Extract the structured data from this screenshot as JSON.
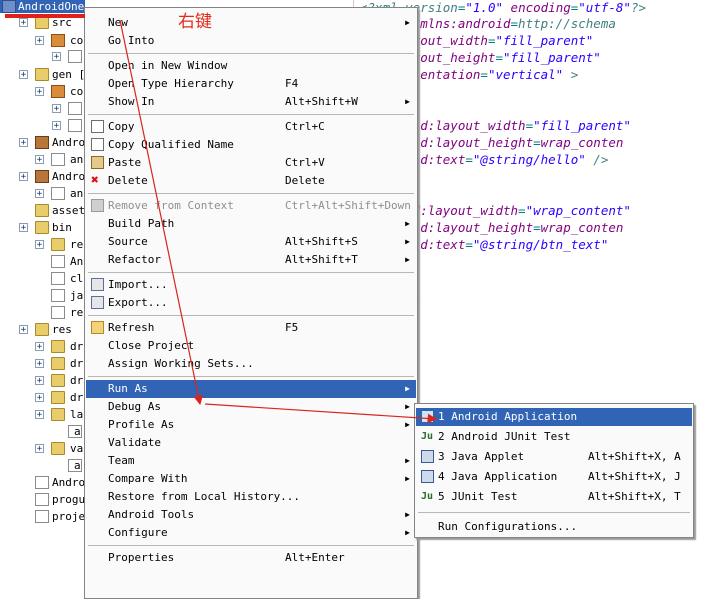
{
  "tree": {
    "project_name": "AndroidOne",
    "rows": [
      {
        "label": "src"
      },
      {
        "label": "co"
      },
      {
        "label": "J"
      },
      {
        "label": "gen ["
      },
      {
        "label": "co"
      },
      {
        "label": "J"
      },
      {
        "label": "J"
      },
      {
        "label": "Andro"
      },
      {
        "label": "and"
      },
      {
        "label": "Andro"
      },
      {
        "label": "and"
      },
      {
        "label": "asset"
      },
      {
        "label": "bin"
      },
      {
        "label": "re"
      },
      {
        "label": "An"
      },
      {
        "label": "cl"
      },
      {
        "label": "ja"
      },
      {
        "label": "re"
      },
      {
        "label": "res"
      },
      {
        "label": "dr"
      },
      {
        "label": "dr"
      },
      {
        "label": "dr"
      },
      {
        "label": "dr"
      },
      {
        "label": "la"
      },
      {
        "label": "a"
      },
      {
        "label": "va"
      },
      {
        "label": "a"
      },
      {
        "label": "Andro"
      },
      {
        "label": "progu"
      },
      {
        "label": "proje"
      }
    ]
  },
  "annotation": {
    "text": "右键"
  },
  "editor": {
    "lines": [
      "<?xml version=\"1.0\" encoding=\"utf-8\"?>",
      "Layout xmlns:android=\"http://schema",
      "roid:layout_width=\"fill_parent\"",
      "roid:layout_height=\"fill_parent\"",
      "roid:orientation=\"vertical\" >",
      "",
      "xtView",
      "  android:layout_width=\"fill_parent\"",
      "  android:layout_height=\"wrap_conten",
      "  android:text=\"@string/hello\" />",
      "",
      "tton",
      " android:layout_width=\"wrap_content\"",
      "  android:layout_height=\"wrap_conten",
      "  android:text=\"@string/btn_text\"",
      "  />",
      "",
      "rLayout>"
    ]
  },
  "context_menu": {
    "items": [
      {
        "label": "New",
        "accel": "",
        "arrow": true
      },
      {
        "label": "Go Into",
        "accel": "",
        "arrow": false
      },
      {
        "sep": true
      },
      {
        "label": "Open in New Window",
        "accel": "",
        "arrow": false
      },
      {
        "label": "Open Type Hierarchy",
        "accel": "F4",
        "arrow": false
      },
      {
        "label": "Show In",
        "accel": "Alt+Shift+W",
        "arrow": true
      },
      {
        "sep": true
      },
      {
        "label": "Copy",
        "accel": "Ctrl+C",
        "arrow": false,
        "icon": "copy"
      },
      {
        "label": "Copy Qualified Name",
        "accel": "",
        "arrow": false,
        "icon": "copy"
      },
      {
        "label": "Paste",
        "accel": "Ctrl+V",
        "arrow": false,
        "icon": "paste"
      },
      {
        "label": "Delete",
        "accel": "Delete",
        "arrow": false,
        "icon": "delete"
      },
      {
        "sep": true
      },
      {
        "label": "Remove from Context",
        "accel": "Ctrl+Alt+Shift+Down",
        "arrow": false,
        "disabled": true,
        "icon": "remove"
      },
      {
        "label": "Build Path",
        "accel": "",
        "arrow": true
      },
      {
        "label": "Source",
        "accel": "Alt+Shift+S",
        "arrow": true
      },
      {
        "label": "Refactor",
        "accel": "Alt+Shift+T",
        "arrow": true
      },
      {
        "sep": true
      },
      {
        "label": "Import...",
        "accel": "",
        "arrow": false,
        "icon": "import"
      },
      {
        "label": "Export...",
        "accel": "",
        "arrow": false,
        "icon": "export"
      },
      {
        "sep": true
      },
      {
        "label": "Refresh",
        "accel": "F5",
        "arrow": false,
        "icon": "refresh"
      },
      {
        "label": "Close Project",
        "accel": "",
        "arrow": false
      },
      {
        "label": "Assign Working Sets...",
        "accel": "",
        "arrow": false
      },
      {
        "sep": true
      },
      {
        "label": "Run As",
        "accel": "",
        "arrow": true,
        "highlight": true
      },
      {
        "label": "Debug As",
        "accel": "",
        "arrow": true
      },
      {
        "label": "Profile As",
        "accel": "",
        "arrow": true
      },
      {
        "label": "Validate",
        "accel": "",
        "arrow": false
      },
      {
        "label": "Team",
        "accel": "",
        "arrow": true
      },
      {
        "label": "Compare With",
        "accel": "",
        "arrow": true
      },
      {
        "label": "Restore from Local History...",
        "accel": "",
        "arrow": false
      },
      {
        "label": "Android Tools",
        "accel": "",
        "arrow": true
      },
      {
        "label": "Configure",
        "accel": "",
        "arrow": true
      },
      {
        "sep": true
      },
      {
        "label": "Properties",
        "accel": "Alt+Enter",
        "arrow": false
      }
    ]
  },
  "submenu": {
    "items": [
      {
        "label": "1 Android Application",
        "accel": "",
        "highlight": true,
        "icon": "android"
      },
      {
        "label": "2 Android JUnit Test",
        "accel": "",
        "icon": "junit"
      },
      {
        "label": "3 Java Applet",
        "accel": "Alt+Shift+X, A",
        "icon": "applet"
      },
      {
        "label": "4 Java Application",
        "accel": "Alt+Shift+X, J",
        "icon": "javaapp"
      },
      {
        "label": "5 JUnit Test",
        "accel": "Alt+Shift+X, T",
        "icon": "junit5"
      },
      {
        "sep": true
      },
      {
        "label": "Run Configurations...",
        "accel": ""
      }
    ]
  },
  "colors": {
    "highlight": "#3264b5",
    "annotation_red": "#e0201a",
    "menu_bg": "#fafafa"
  }
}
